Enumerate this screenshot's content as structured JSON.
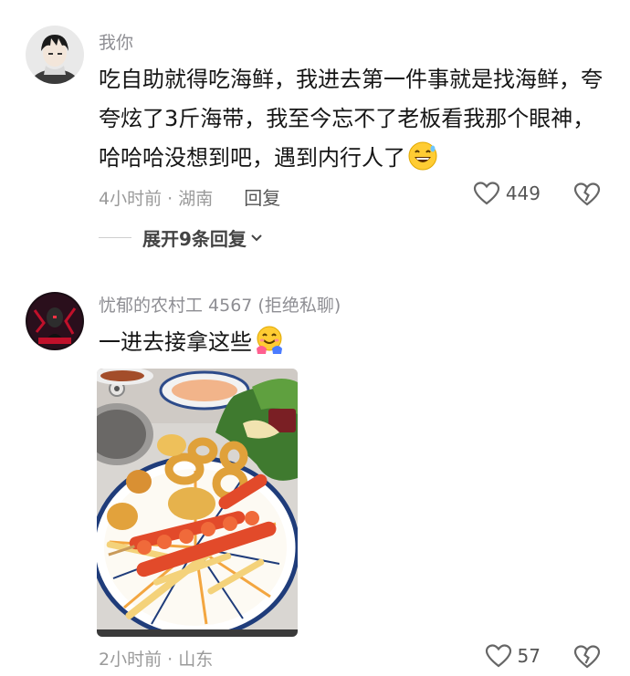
{
  "comments": [
    {
      "username": "我你",
      "text": "吃自助就得吃海鲜，我进去第一件事就是找海鲜，夸夸炫了3斤海带，我至今忘不了老板看我那个眼神，哈哈哈没想到吧，遇到内行人了",
      "emoji": "grinning-sweat-emoji",
      "time_location": "4小时前 · 湖南",
      "reply_label": "回复",
      "likes": "449",
      "expand_label": "展开9条回复"
    },
    {
      "username": "忧郁的农村工 4567 (拒绝私聊)",
      "text": "一进去接拿这些",
      "emoji": "hugging-face-emoji",
      "time_location": "2小时前 · 山东",
      "likes": "57"
    }
  ],
  "colors": {
    "meta_gray": "#9a9a9a",
    "text_dark": "#161616",
    "username_gray": "#8e8e93"
  }
}
